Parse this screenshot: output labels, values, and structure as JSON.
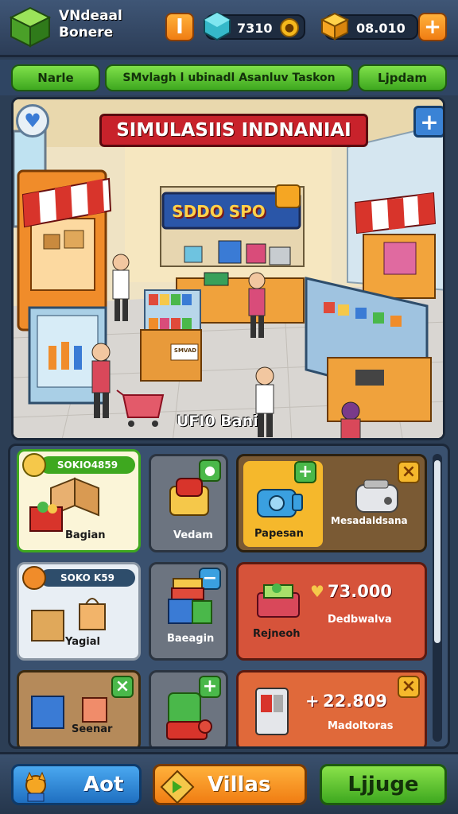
{
  "header": {
    "title_line1": "VNdeaal",
    "title_line2": "Bonere",
    "action_glyph": "I",
    "gem_amount": "7310",
    "gold_amount": "08.010",
    "add_glyph": "+"
  },
  "tabs": [
    {
      "label": "Narle"
    },
    {
      "label": "SMvlagh l ubinadl Asanluv Taskon"
    },
    {
      "label": "Ljpdam"
    }
  ],
  "scene": {
    "banner_title": "SIMULASIIS INDNANIAI",
    "shop_sign": "SDDO SPO",
    "counter_label": "SMVAD",
    "floor_caption": "UFI0 Bani"
  },
  "panel": {
    "cards": [
      {
        "id": "bagian",
        "tag": "SOKIO4859",
        "label": "Bagian"
      },
      {
        "id": "vedam",
        "label": "Vedam"
      },
      {
        "id": "papesan",
        "label": "Papesan"
      },
      {
        "id": "mesadel",
        "label": "Mesadaldsana"
      },
      {
        "id": "yagial",
        "tag": "SOKO K59",
        "label": "Yagial"
      },
      {
        "id": "baeagin",
        "label": "Baeagin"
      },
      {
        "id": "rejneoh",
        "label": "Rejneoh",
        "price": "73.000",
        "price_icon": "heart-icon",
        "sub": "Dedbwalva"
      },
      {
        "id": "seenar",
        "label": "Seenar"
      },
      {
        "id": "machine",
        "label": ""
      },
      {
        "id": "madoltoras",
        "price": "22.809",
        "price_prefix": "+",
        "sub": "Madoltoras"
      }
    ]
  },
  "bottom": {
    "left_label": "Aot",
    "center_label": "Villas",
    "right_label": "Ljjuge"
  },
  "colors": {
    "green": "#3ea81f",
    "orange": "#f07d13",
    "red_card": "#d6533a",
    "banner_red": "#c8222b"
  }
}
